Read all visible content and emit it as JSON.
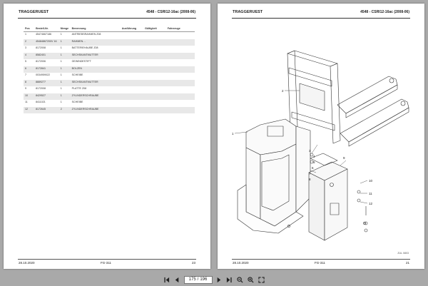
{
  "left_page": {
    "title": "TRAGGERUEST",
    "model": "4548 - CSRI12-16ac (2008-06)",
    "table": {
      "columns": [
        "Pos",
        "Bestell-Nr.",
        "Menge",
        "Benennung",
        "Ausführung",
        "Gültigkeit",
        "Fahrzeuge"
      ],
      "rows": [
        [
          "1",
          "45474667186",
          "1",
          "ANTRIEBSRAHMEN Z08",
          "",
          "",
          ""
        ],
        [
          "2",
          "45484867200V 16",
          "1",
          "RAHMEN…",
          "",
          "",
          ""
        ],
        [
          "3",
          "8172008",
          "1",
          "BATTERIEHAUBE Z08",
          "",
          "",
          ""
        ],
        [
          "4",
          "8582401",
          "1",
          "SECHSKANTMUTTER",
          "",
          "",
          ""
        ],
        [
          "5",
          "8172006",
          "1",
          "GEWINDESTIFT",
          "",
          "",
          ""
        ],
        [
          "6",
          "8172841",
          "1",
          "BOLZEN",
          "",
          "",
          ""
        ],
        [
          "7",
          "0034959022",
          "1",
          "SCHEIBE",
          "",
          "",
          ""
        ],
        [
          "8",
          "8889277",
          "1",
          "SECHSKANTMUTTER",
          "",
          "",
          ""
        ],
        [
          "9",
          "8172008",
          "1",
          "PLATTE Z08",
          "",
          "",
          ""
        ],
        [
          "10",
          "8429527",
          "1",
          "ZYLINDERSCHRAUBE",
          "",
          "",
          ""
        ],
        [
          "11",
          "8411021",
          "1",
          "SCHEIBE",
          "",
          "",
          ""
        ],
        [
          "12",
          "8172645",
          "2",
          "ZYLINDERSCHRAUBE",
          "",
          "",
          ""
        ]
      ]
    },
    "footer": {
      "date": "28.10.2020",
      "code": "FG-311",
      "page_number": "23"
    }
  },
  "right_page": {
    "title": "TRAGGERUEST",
    "model": "4548 - CSRI12-16ac (2008-06)",
    "figure_id": "ZUL 0803",
    "callouts": [
      "2",
      "1",
      "3",
      "4",
      "5",
      "6",
      "7",
      "8",
      "9",
      "10",
      "11",
      "12"
    ],
    "footer": {
      "date": "28.10.2020",
      "code": "FG-311",
      "page_number": "21"
    }
  },
  "toolbar": {
    "current_page": "175",
    "separator": "/",
    "total_pages": "196"
  },
  "colors": {
    "background": "#a9a9a9",
    "page": "#ffffff",
    "row_stripe": "#e8e8e8"
  }
}
